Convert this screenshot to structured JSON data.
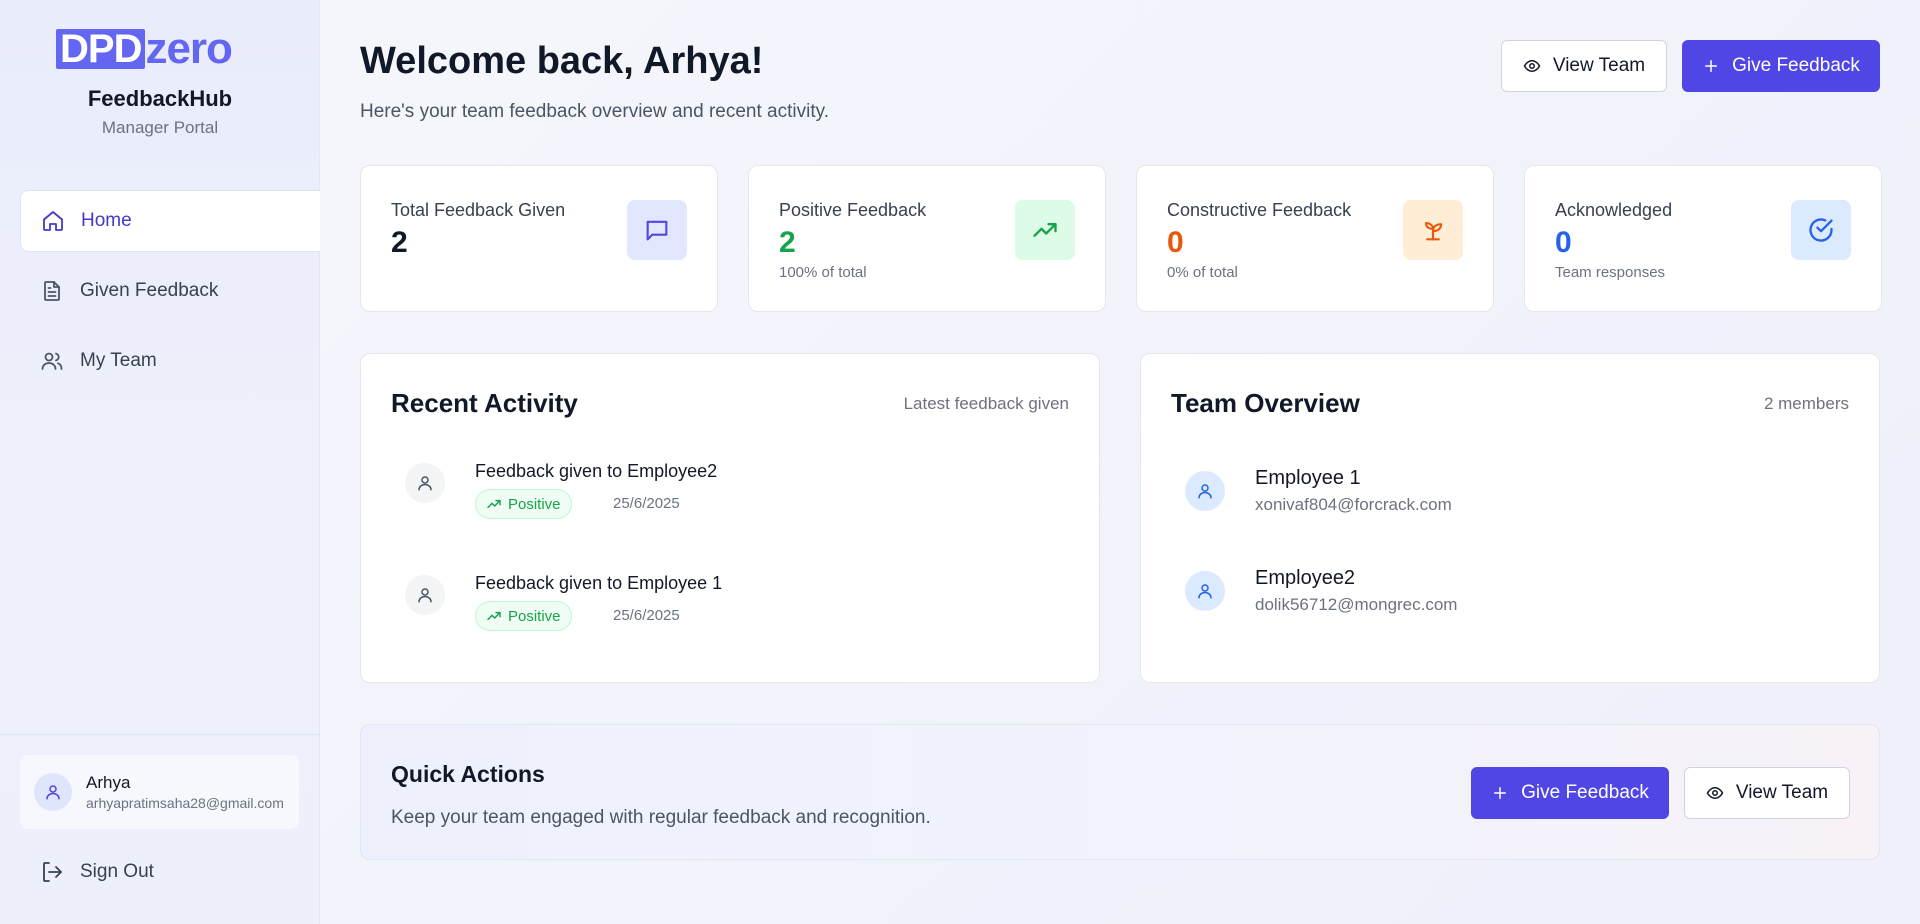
{
  "brand": {
    "logo_box": "DPD",
    "logo_rest": "zero",
    "name": "FeedbackHub",
    "subtitle": "Manager Portal"
  },
  "nav": {
    "items": [
      {
        "label": "Home",
        "icon": "home-icon",
        "active": true
      },
      {
        "label": "Given Feedback",
        "icon": "document-icon",
        "active": false
      },
      {
        "label": "My Team",
        "icon": "users-icon",
        "active": false
      }
    ]
  },
  "user": {
    "name": "Arhya",
    "email": "arhyapratimsaha28@gmail.com"
  },
  "signout_label": "Sign Out",
  "header": {
    "welcome": "Welcome back, Arhya!",
    "subtitle": "Here's your team feedback overview and recent activity.",
    "view_team_label": "View Team",
    "give_feedback_label": "Give Feedback"
  },
  "stats": [
    {
      "label": "Total Feedback Given",
      "value": "2",
      "sub": "",
      "icon": "message-icon",
      "color": "#111827",
      "icon_bg": "#e0e7ff",
      "icon_color": "#4f46e5"
    },
    {
      "label": "Positive Feedback",
      "value": "2",
      "sub": "100% of total",
      "icon": "trending-up-icon",
      "color": "#16a34a",
      "icon_bg": "#dcfce7",
      "icon_color": "#16a34a"
    },
    {
      "label": "Constructive Feedback",
      "value": "0",
      "sub": "0% of total",
      "icon": "sprout-icon",
      "color": "#ea580c",
      "icon_bg": "#ffedd5",
      "icon_color": "#ea580c"
    },
    {
      "label": "Acknowledged",
      "value": "0",
      "sub": "Team responses",
      "icon": "check-circle-icon",
      "color": "#2563eb",
      "icon_bg": "#dbeafe",
      "icon_color": "#2563eb"
    }
  ],
  "recent_activity": {
    "title": "Recent Activity",
    "meta": "Latest feedback given",
    "items": [
      {
        "title": "Feedback given to Employee2",
        "badge": "Positive",
        "date": "25/6/2025"
      },
      {
        "title": "Feedback given to Employee 1",
        "badge": "Positive",
        "date": "25/6/2025"
      }
    ]
  },
  "team_overview": {
    "title": "Team Overview",
    "meta": "2 members",
    "members": [
      {
        "name": "Employee 1",
        "email": "xonivaf804@forcrack.com"
      },
      {
        "name": "Employee2",
        "email": "dolik56712@mongrec.com"
      }
    ]
  },
  "quick_actions": {
    "title": "Quick Actions",
    "subtitle": "Keep your team engaged with regular feedback and recognition.",
    "give_feedback_label": "Give Feedback",
    "view_team_label": "View Team"
  },
  "colors": {
    "primary": "#4f46e5",
    "brand": "#6366f1",
    "positive": "#16a34a"
  }
}
